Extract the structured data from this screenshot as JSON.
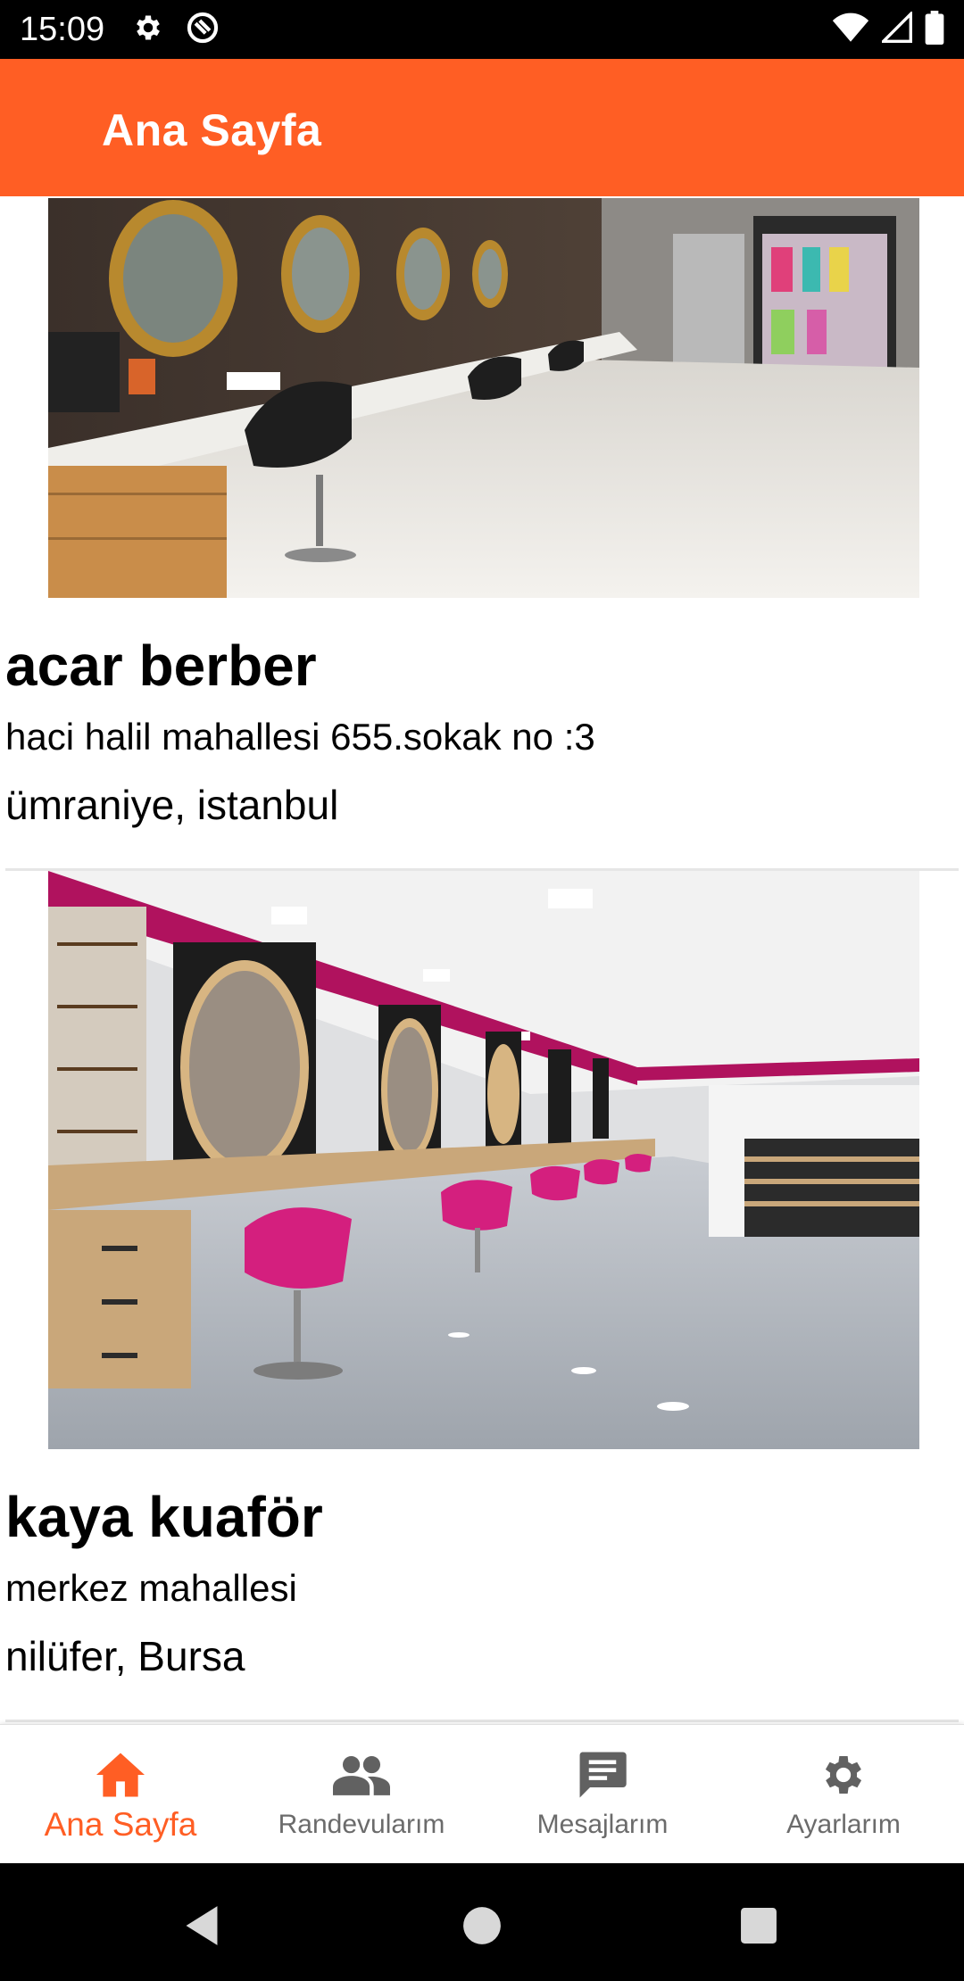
{
  "status_bar": {
    "time": "15:09",
    "icons_left": [
      "settings-icon",
      "at-sign-icon"
    ],
    "icons_right": [
      "wifi-icon",
      "signal-icon",
      "battery-icon"
    ]
  },
  "app_bar": {
    "title": "Ana Sayfa",
    "color": "#ff5e24"
  },
  "salons": [
    {
      "name": "acar berber",
      "address": "haci halil mahallesi 655.sokak no :3",
      "city": "ümraniye, istanbul",
      "image": "salon-interior-gold-mirrors"
    },
    {
      "name": "kaya kuaför",
      "address": "merkez mahallesi",
      "city": "nilüfer, Bursa",
      "image": "salon-interior-pink-chairs"
    }
  ],
  "bottom_nav": {
    "active_color": "#ff5e24",
    "inactive_color": "#6b6b6b",
    "items": [
      {
        "label": "Ana Sayfa",
        "icon": "home-icon",
        "active": true
      },
      {
        "label": "Randevularım",
        "icon": "people-icon",
        "active": false
      },
      {
        "label": "Mesajlarım",
        "icon": "message-icon",
        "active": false
      },
      {
        "label": "Ayarlarım",
        "icon": "gear-icon",
        "active": false
      }
    ]
  },
  "system_nav": {
    "buttons": [
      "back-icon",
      "home-circle-icon",
      "recents-icon"
    ]
  }
}
